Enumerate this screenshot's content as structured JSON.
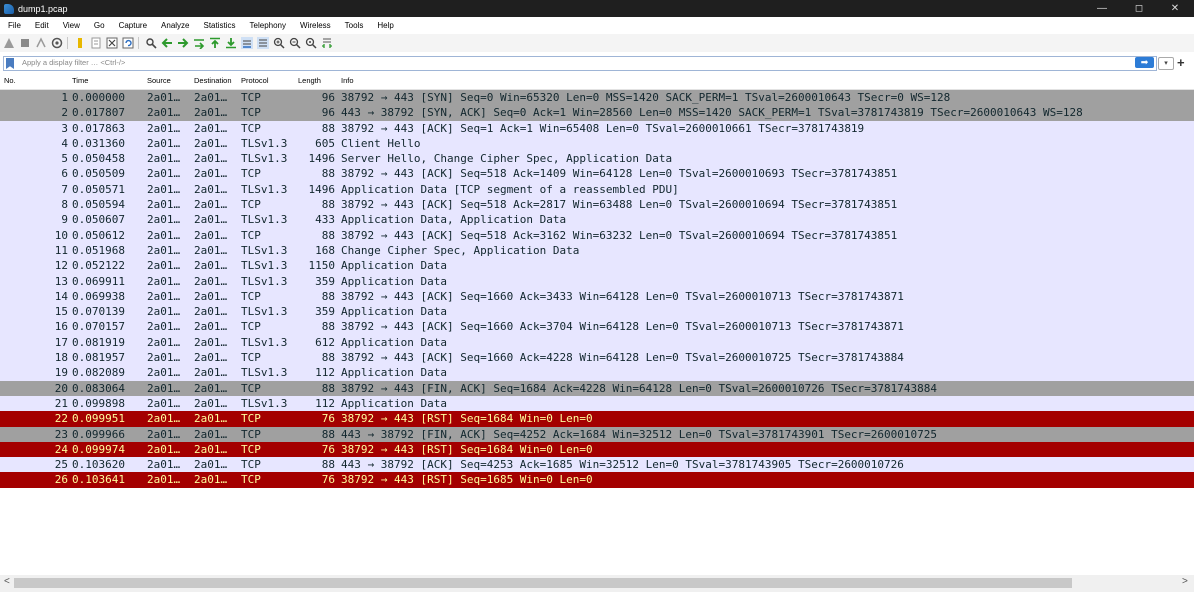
{
  "window": {
    "title": "dump1.pcap",
    "controls": [
      "—",
      "◻",
      "✕"
    ]
  },
  "menu": [
    "File",
    "Edit",
    "View",
    "Go",
    "Capture",
    "Analyze",
    "Statistics",
    "Telephony",
    "Wireless",
    "Tools",
    "Help"
  ],
  "toolbar": {
    "icons": [
      "start-capture-icon",
      "stop-capture-icon",
      "restart-capture-icon",
      "capture-options-icon",
      "open-file-icon",
      "save-file-icon",
      "close-file-icon",
      "reload-file-icon",
      "find-packet-icon",
      "go-back-icon",
      "go-forward-icon",
      "go-to-packet-icon",
      "go-first-icon",
      "go-last-icon",
      "auto-scroll-icon",
      "colorize-icon",
      "zoom-in-icon",
      "zoom-out-icon",
      "normal-size-icon",
      "resize-columns-icon"
    ]
  },
  "filter": {
    "placeholder": "Apply a display filter … <Ctrl-/>",
    "apply_icon": "arrow-right-icon",
    "dropdown": "▾",
    "add": "+"
  },
  "columns": {
    "no": "No.",
    "time": "Time",
    "source": "Source",
    "destination": "Destination",
    "protocol": "Protocol",
    "length": "Length",
    "info": "Info"
  },
  "packets": [
    {
      "no": "1",
      "time": "0.000000",
      "src": "2a01…",
      "dst": "2a01…",
      "proto": "TCP",
      "len": "96",
      "info": "38792 → 443 [SYN] Seq=0 Win=65320 Len=0 MSS=1420 SACK_PERM=1 TSval=2600010643 TSecr=0 WS=128",
      "color": "gray"
    },
    {
      "no": "2",
      "time": "0.017807",
      "src": "2a01…",
      "dst": "2a01…",
      "proto": "TCP",
      "len": "96",
      "info": "443 → 38792 [SYN, ACK] Seq=0 Ack=1 Win=28560 Len=0 MSS=1420 SACK_PERM=1 TSval=3781743819 TSecr=2600010643 WS=128",
      "color": "gray"
    },
    {
      "no": "3",
      "time": "0.017863",
      "src": "2a01…",
      "dst": "2a01…",
      "proto": "TCP",
      "len": "88",
      "info": "38792 → 443 [ACK] Seq=1 Ack=1 Win=65408 Len=0 TSval=2600010661 TSecr=3781743819",
      "color": "lav"
    },
    {
      "no": "4",
      "time": "0.031360",
      "src": "2a01…",
      "dst": "2a01…",
      "proto": "TLSv1.3",
      "len": "605",
      "info": "Client Hello",
      "color": "lav"
    },
    {
      "no": "5",
      "time": "0.050458",
      "src": "2a01…",
      "dst": "2a01…",
      "proto": "TLSv1.3",
      "len": "1496",
      "info": "Server Hello, Change Cipher Spec, Application Data",
      "color": "lav"
    },
    {
      "no": "6",
      "time": "0.050509",
      "src": "2a01…",
      "dst": "2a01…",
      "proto": "TCP",
      "len": "88",
      "info": "38792 → 443 [ACK] Seq=518 Ack=1409 Win=64128 Len=0 TSval=2600010693 TSecr=3781743851",
      "color": "lav"
    },
    {
      "no": "7",
      "time": "0.050571",
      "src": "2a01…",
      "dst": "2a01…",
      "proto": "TLSv1.3",
      "len": "1496",
      "info": "Application Data [TCP segment of a reassembled PDU]",
      "color": "lav"
    },
    {
      "no": "8",
      "time": "0.050594",
      "src": "2a01…",
      "dst": "2a01…",
      "proto": "TCP",
      "len": "88",
      "info": "38792 → 443 [ACK] Seq=518 Ack=2817 Win=63488 Len=0 TSval=2600010694 TSecr=3781743851",
      "color": "lav"
    },
    {
      "no": "9",
      "time": "0.050607",
      "src": "2a01…",
      "dst": "2a01…",
      "proto": "TLSv1.3",
      "len": "433",
      "info": "Application Data, Application Data",
      "color": "lav"
    },
    {
      "no": "10",
      "time": "0.050612",
      "src": "2a01…",
      "dst": "2a01…",
      "proto": "TCP",
      "len": "88",
      "info": "38792 → 443 [ACK] Seq=518 Ack=3162 Win=63232 Len=0 TSval=2600010694 TSecr=3781743851",
      "color": "lav"
    },
    {
      "no": "11",
      "time": "0.051968",
      "src": "2a01…",
      "dst": "2a01…",
      "proto": "TLSv1.3",
      "len": "168",
      "info": "Change Cipher Spec, Application Data",
      "color": "lav"
    },
    {
      "no": "12",
      "time": "0.052122",
      "src": "2a01…",
      "dst": "2a01…",
      "proto": "TLSv1.3",
      "len": "1150",
      "info": "Application Data",
      "color": "lav"
    },
    {
      "no": "13",
      "time": "0.069911",
      "src": "2a01…",
      "dst": "2a01…",
      "proto": "TLSv1.3",
      "len": "359",
      "info": "Application Data",
      "color": "lav"
    },
    {
      "no": "14",
      "time": "0.069938",
      "src": "2a01…",
      "dst": "2a01…",
      "proto": "TCP",
      "len": "88",
      "info": "38792 → 443 [ACK] Seq=1660 Ack=3433 Win=64128 Len=0 TSval=2600010713 TSecr=3781743871",
      "color": "lav"
    },
    {
      "no": "15",
      "time": "0.070139",
      "src": "2a01…",
      "dst": "2a01…",
      "proto": "TLSv1.3",
      "len": "359",
      "info": "Application Data",
      "color": "lav"
    },
    {
      "no": "16",
      "time": "0.070157",
      "src": "2a01…",
      "dst": "2a01…",
      "proto": "TCP",
      "len": "88",
      "info": "38792 → 443 [ACK] Seq=1660 Ack=3704 Win=64128 Len=0 TSval=2600010713 TSecr=3781743871",
      "color": "lav"
    },
    {
      "no": "17",
      "time": "0.081919",
      "src": "2a01…",
      "dst": "2a01…",
      "proto": "TLSv1.3",
      "len": "612",
      "info": "Application Data",
      "color": "lav"
    },
    {
      "no": "18",
      "time": "0.081957",
      "src": "2a01…",
      "dst": "2a01…",
      "proto": "TCP",
      "len": "88",
      "info": "38792 → 443 [ACK] Seq=1660 Ack=4228 Win=64128 Len=0 TSval=2600010725 TSecr=3781743884",
      "color": "lav"
    },
    {
      "no": "19",
      "time": "0.082089",
      "src": "2a01…",
      "dst": "2a01…",
      "proto": "TLSv1.3",
      "len": "112",
      "info": "Application Data",
      "color": "lav"
    },
    {
      "no": "20",
      "time": "0.083064",
      "src": "2a01…",
      "dst": "2a01…",
      "proto": "TCP",
      "len": "88",
      "info": "38792 → 443 [FIN, ACK] Seq=1684 Ack=4228 Win=64128 Len=0 TSval=2600010726 TSecr=3781743884",
      "color": "gray"
    },
    {
      "no": "21",
      "time": "0.099898",
      "src": "2a01…",
      "dst": "2a01…",
      "proto": "TLSv1.3",
      "len": "112",
      "info": "Application Data",
      "color": "lav"
    },
    {
      "no": "22",
      "time": "0.099951",
      "src": "2a01…",
      "dst": "2a01…",
      "proto": "TCP",
      "len": "76",
      "info": "38792 → 443 [RST] Seq=1684 Win=0 Len=0",
      "color": "red"
    },
    {
      "no": "23",
      "time": "0.099966",
      "src": "2a01…",
      "dst": "2a01…",
      "proto": "TCP",
      "len": "88",
      "info": "443 → 38792 [FIN, ACK] Seq=4252 Ack=1684 Win=32512 Len=0 TSval=3781743901 TSecr=2600010725",
      "color": "gray"
    },
    {
      "no": "24",
      "time": "0.099974",
      "src": "2a01…",
      "dst": "2a01…",
      "proto": "TCP",
      "len": "76",
      "info": "38792 → 443 [RST] Seq=1684 Win=0 Len=0",
      "color": "red"
    },
    {
      "no": "25",
      "time": "0.103620",
      "src": "2a01…",
      "dst": "2a01…",
      "proto": "TCP",
      "len": "88",
      "info": "443 → 38792 [ACK] Seq=4253 Ack=1685 Win=32512 Len=0 TSval=3781743905 TSecr=2600010726",
      "color": "lav"
    },
    {
      "no": "26",
      "time": "0.103641",
      "src": "2a01…",
      "dst": "2a01…",
      "proto": "TCP",
      "len": "76",
      "info": "38792 → 443 [RST] Seq=1685 Win=0 Len=0",
      "color": "red"
    }
  ],
  "scrollbar": {
    "left": "<",
    "right": ">"
  }
}
